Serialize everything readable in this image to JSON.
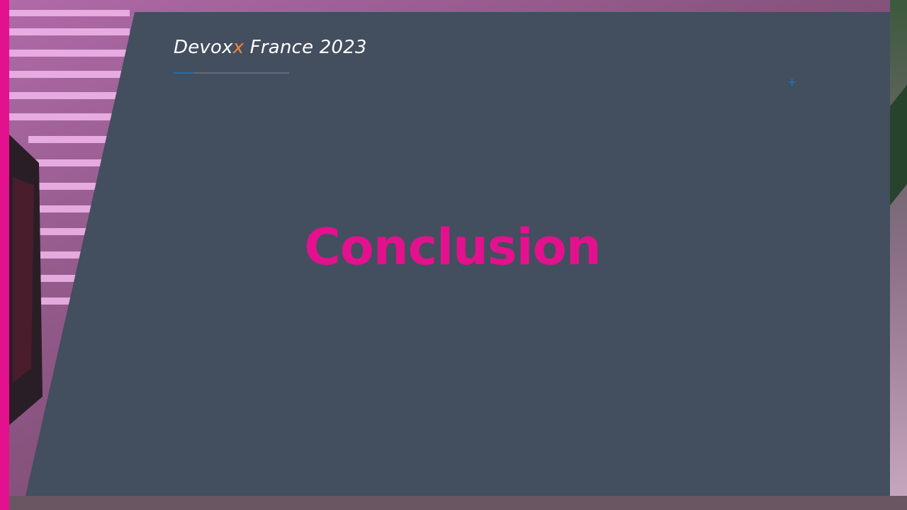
{
  "slide": {
    "event_name_prefix": "Devox",
    "event_name_accent": "x",
    "event_name_suffix": " France 2023",
    "heading": "Conclusion",
    "plus_symbol": "+"
  },
  "colors": {
    "panel": "#434e5e",
    "heading": "#e3118e",
    "accent_stripe": "#e3118e",
    "logo_x": "#f0883a",
    "plus_mark": "#1e6fb0"
  }
}
